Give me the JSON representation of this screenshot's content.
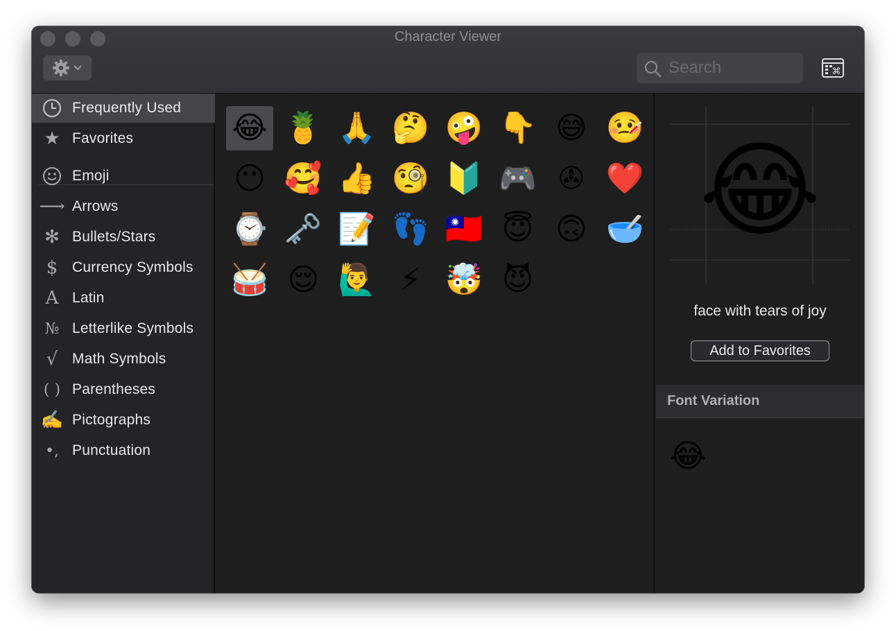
{
  "window": {
    "title": "Character Viewer"
  },
  "toolbar": {
    "search_placeholder": "Search",
    "gear_icon": "gear-icon",
    "keyboard_icon": "keyboard-viewer-icon"
  },
  "sidebar": {
    "items": [
      {
        "label": "Frequently Used",
        "icon": "clock-icon",
        "glyph": "",
        "selected": true
      },
      {
        "label": "Favorites",
        "icon": "star-icon",
        "glyph": "★",
        "selected": false
      },
      {
        "label": "Emoji",
        "icon": "smiley-icon",
        "glyph": "☺",
        "selected": false
      },
      {
        "label": "Arrows",
        "icon": "arrow-icon",
        "glyph": "⟶",
        "selected": false
      },
      {
        "label": "Bullets/Stars",
        "icon": "asterisk-icon",
        "glyph": "✻",
        "selected": false
      },
      {
        "label": "Currency Symbols",
        "icon": "dollar-icon",
        "glyph": "$",
        "selected": false
      },
      {
        "label": "Latin",
        "icon": "letter-a-icon",
        "glyph": "A",
        "selected": false
      },
      {
        "label": "Letterlike Symbols",
        "icon": "numero-icon",
        "glyph": "№",
        "selected": false
      },
      {
        "label": "Math Symbols",
        "icon": "square-root-icon",
        "glyph": "√",
        "selected": false
      },
      {
        "label": "Parentheses",
        "icon": "parentheses-icon",
        "glyph": "( )",
        "selected": false
      },
      {
        "label": "Pictographs",
        "icon": "writing-hand-icon",
        "glyph": "✍",
        "selected": false
      },
      {
        "label": "Punctuation",
        "icon": "punctuation-icon",
        "glyph": "•,",
        "selected": false
      }
    ]
  },
  "grid": {
    "characters": [
      "😂",
      "🍍",
      "🙏",
      "🤔",
      "🤪",
      "👇",
      "😅",
      "🤒",
      "😶",
      "🥰",
      "👍",
      "🧐",
      "🔰",
      "🎮",
      "✇",
      "❤️",
      "⌚",
      "🗝️",
      "📝",
      "👣",
      "🇹🇼",
      "😇",
      "🙃",
      "🥣",
      "🥁",
      "😌",
      "🙋‍♂️",
      "⚡",
      "🤯",
      "😈"
    ],
    "selected_index": 0
  },
  "detail": {
    "character": "😂",
    "name": "face with tears of joy",
    "add_favorites_label": "Add to Favorites",
    "font_variation_title": "Font Variation",
    "variation_character": "😂"
  },
  "colors": {
    "window_bg": "#1e1e1f",
    "sidebar_bg": "#242426",
    "selection": "#454548",
    "text": "#e8e8ea"
  }
}
